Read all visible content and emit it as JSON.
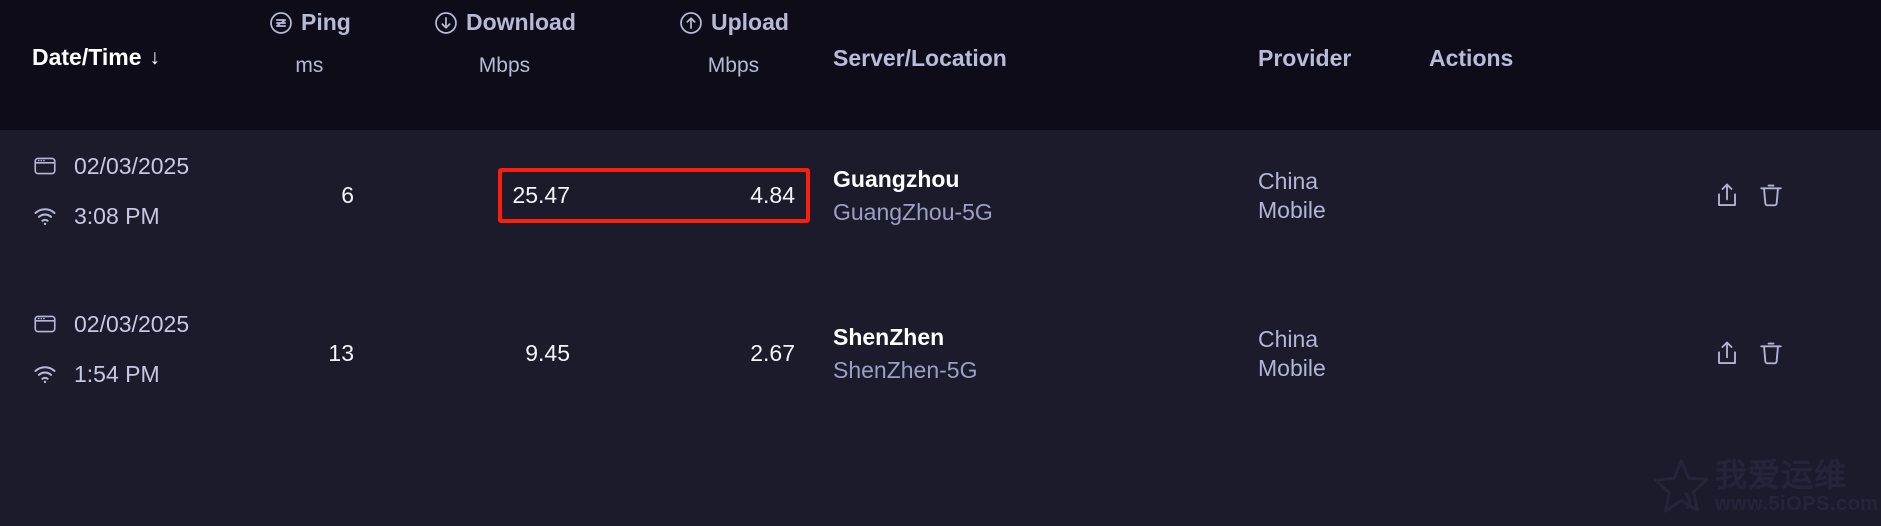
{
  "table": {
    "header": {
      "datetime": {
        "label": "Date/Time",
        "sort_indicator": "↓",
        "icon": "sort-down-icon"
      },
      "ping": {
        "label": "Ping",
        "unit": "ms",
        "icon": "ping-circle-icon"
      },
      "download": {
        "label": "Download",
        "unit": "Mbps",
        "icon": "arrow-down-circle-icon"
      },
      "upload": {
        "label": "Upload",
        "unit": "Mbps",
        "icon": "arrow-up-circle-icon"
      },
      "server": {
        "label": "Server/Location"
      },
      "provider": {
        "label": "Provider"
      },
      "actions": {
        "label": "Actions"
      }
    },
    "rows": [
      {
        "date": "02/03/2025",
        "time": "3:08 PM",
        "date_icon": "browser-window-icon",
        "time_icon": "wifi-icon",
        "ping": "6",
        "download": "25.47",
        "upload": "4.84",
        "server_name": "Guangzhou",
        "server_sub": "GuangZhou-5G",
        "provider_line1": "China",
        "provider_line2": "Mobile",
        "share_icon": "share-upload-icon",
        "delete_icon": "trash-icon"
      },
      {
        "date": "02/03/2025",
        "time": "1:54 PM",
        "date_icon": "browser-window-icon",
        "time_icon": "wifi-icon",
        "ping": "13",
        "download": "9.45",
        "upload": "2.67",
        "server_name": "ShenZhen",
        "server_sub": "ShenZhen-5G",
        "provider_line1": "China",
        "provider_line2": "Mobile",
        "share_icon": "share-upload-icon",
        "delete_icon": "trash-icon"
      }
    ]
  },
  "annotation": {
    "highlight_color": "#fe1d0b",
    "highlight_target": "download-upload-values-row-1"
  },
  "watermark": {
    "cn_text": "我爱运维",
    "url": "www.5iOPS.com"
  },
  "colors": {
    "header_bg": "#0d0c18",
    "row_bg": "#1c1b2c",
    "text_primary": "#ffffff",
    "text_secondary": "#b7bad6",
    "text_muted": "#9b9fc4",
    "accent_red": "#fe1d0b"
  }
}
